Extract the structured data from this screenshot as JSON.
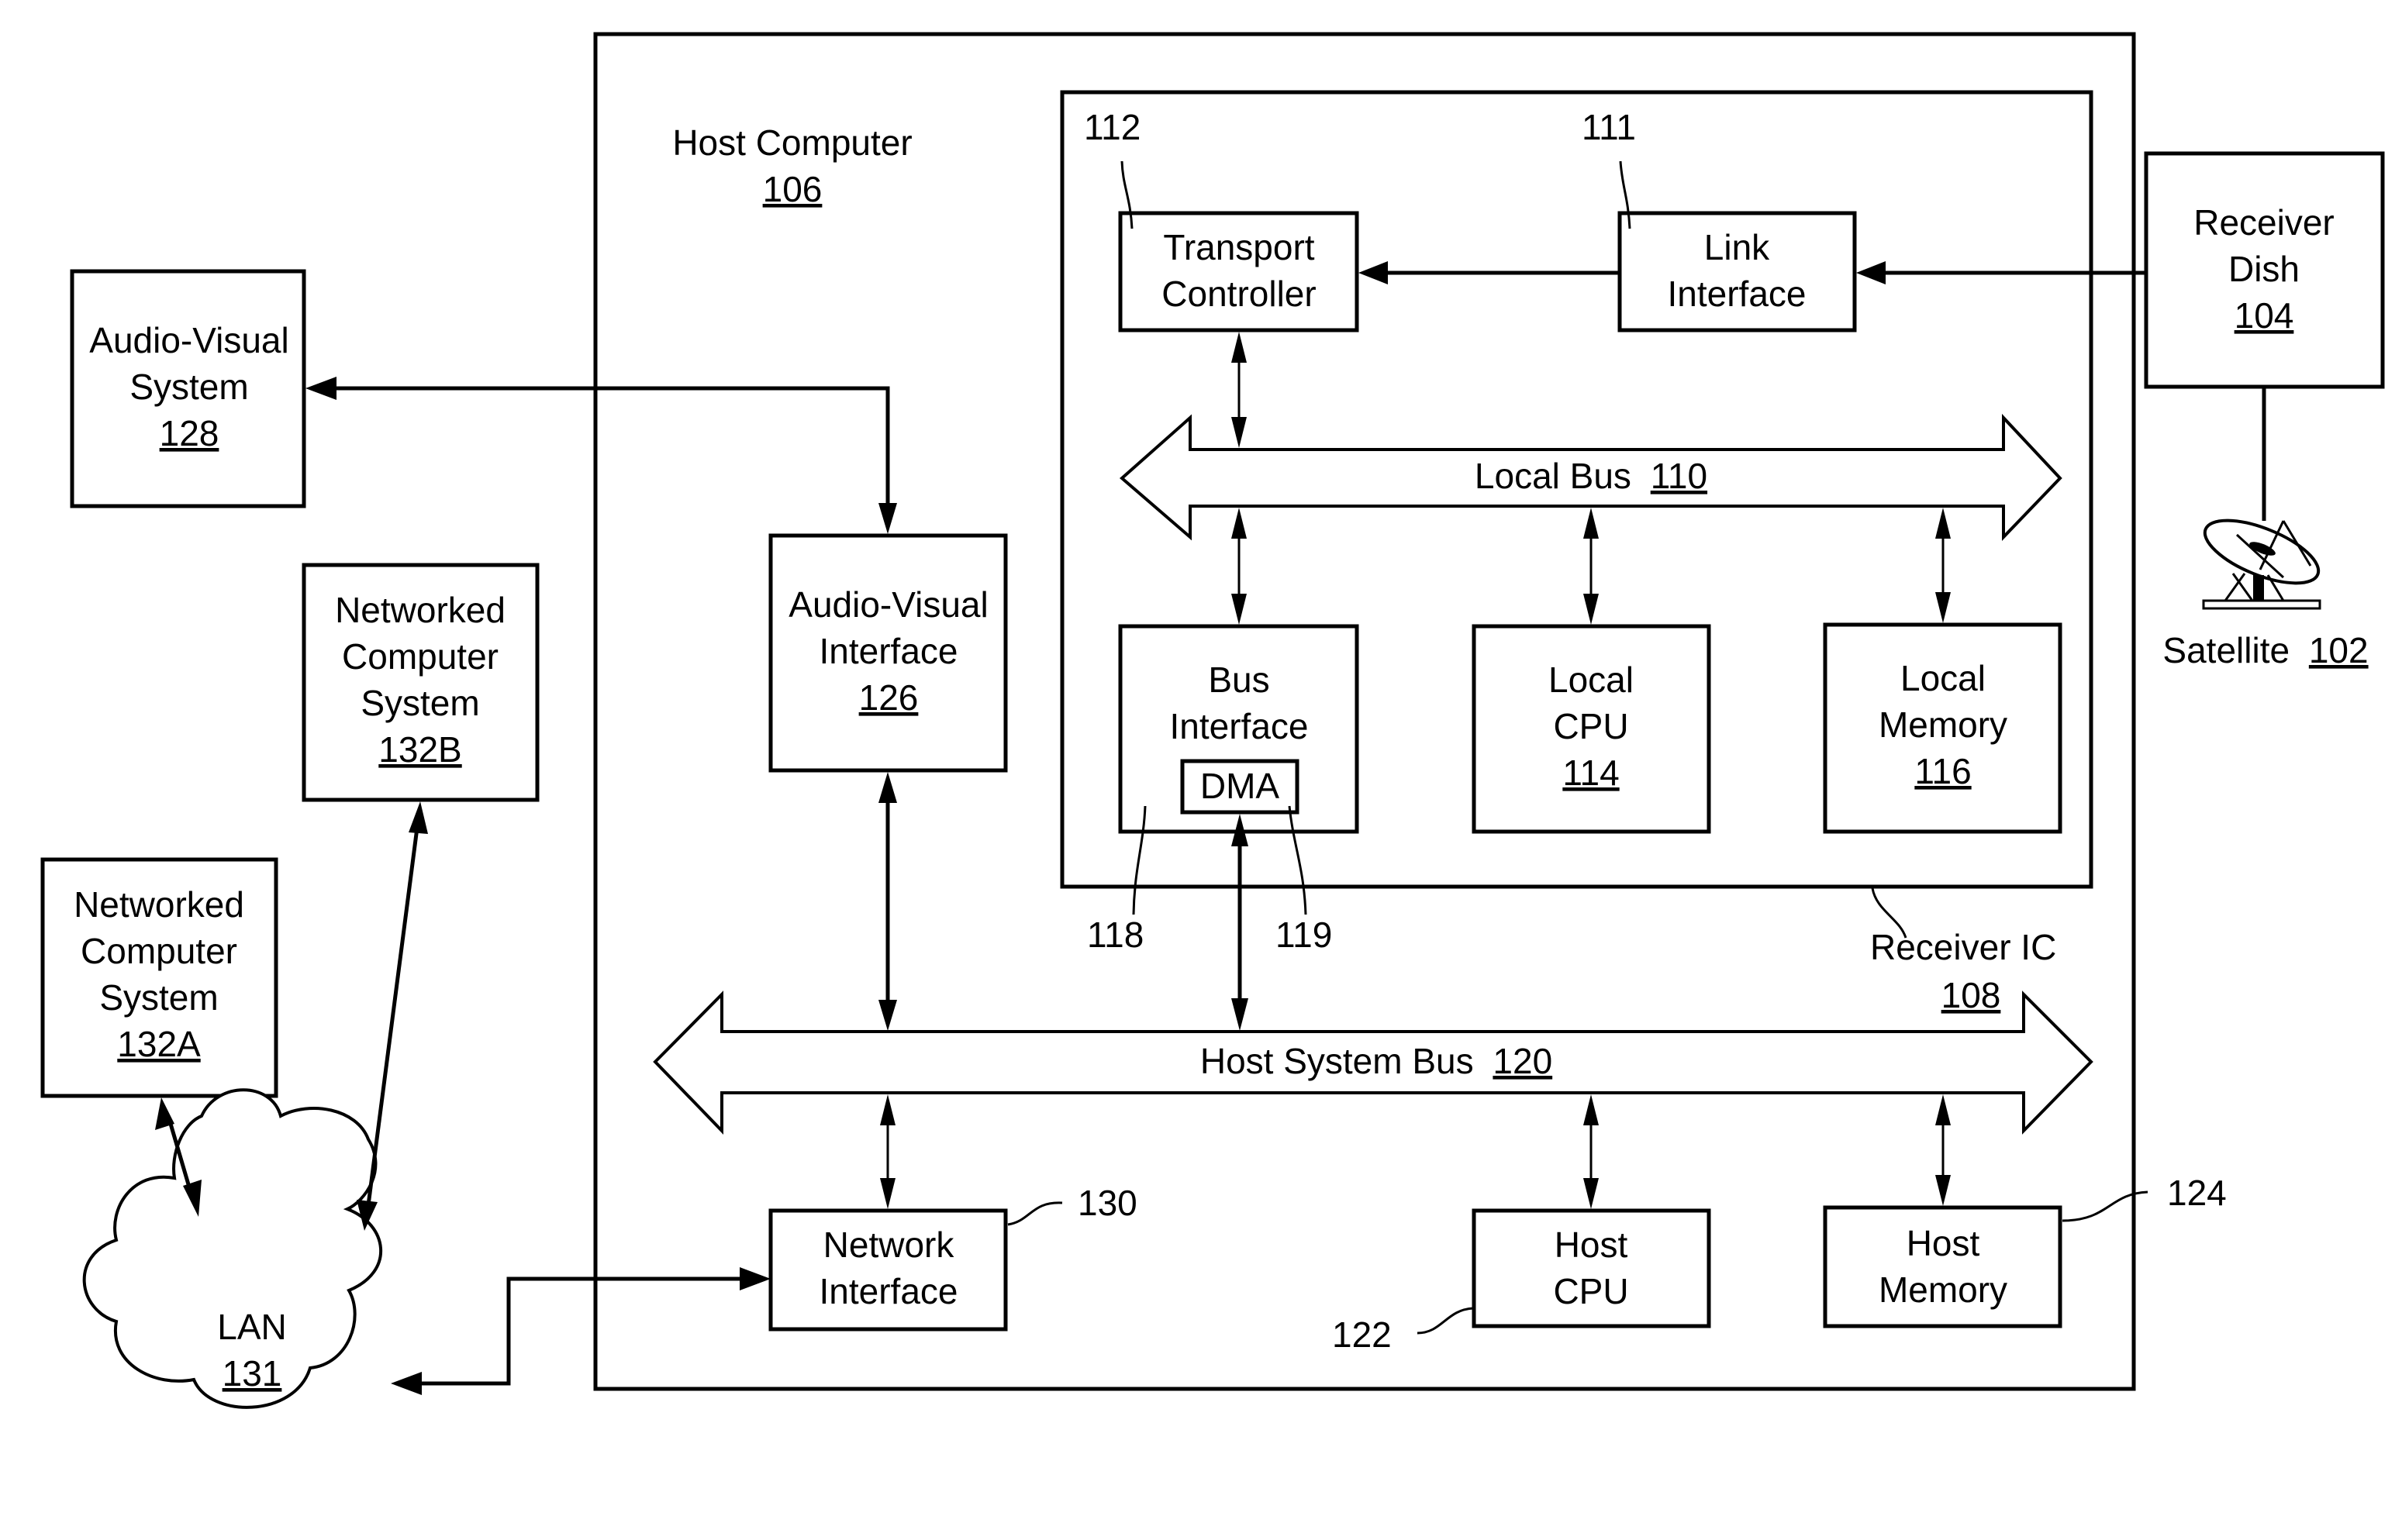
{
  "diagram": {
    "host_computer": {
      "title": "Host Computer",
      "ref": "106"
    },
    "receiver_ic": {
      "title": "Receiver IC",
      "ref": "108"
    },
    "local_bus": {
      "title": "Local Bus",
      "ref": "110"
    },
    "host_system_bus": {
      "title": "Host System Bus",
      "ref": "120"
    },
    "transport_controller": {
      "line1": "Transport",
      "line2": "Controller",
      "callout": "112"
    },
    "link_interface": {
      "line1": "Link",
      "line2": "Interface",
      "callout": "111"
    },
    "receiver_dish": {
      "line1": "Receiver",
      "line2": "Dish",
      "ref": "104"
    },
    "satellite": {
      "title": "Satellite",
      "ref": "102"
    },
    "bus_interface": {
      "line1": "Bus",
      "line2": "Interface",
      "dma": "DMA",
      "callout": "118",
      "dma_callout": "119"
    },
    "local_cpu": {
      "line1": "Local",
      "line2": "CPU",
      "ref": "114"
    },
    "local_memory": {
      "line1": "Local",
      "line2": "Memory",
      "ref": "116"
    },
    "av_system": {
      "line1": "Audio-Visual",
      "line2": "System",
      "ref": "128"
    },
    "av_interface": {
      "line1": "Audio-Visual",
      "line2": "Interface",
      "ref": "126"
    },
    "network_interface": {
      "line1": "Network",
      "line2": "Interface",
      "callout": "130"
    },
    "host_cpu": {
      "line1": "Host",
      "line2": "CPU",
      "callout": "122"
    },
    "host_memory": {
      "line1": "Host",
      "line2": "Memory",
      "callout": "124"
    },
    "networked_b": {
      "line1": "Networked",
      "line2": "Computer",
      "line3": "System",
      "ref": "132B"
    },
    "networked_a": {
      "line1": "Networked",
      "line2": "Computer",
      "line3": "System",
      "ref": "132A"
    },
    "lan": {
      "title": "LAN",
      "ref": "131"
    }
  }
}
